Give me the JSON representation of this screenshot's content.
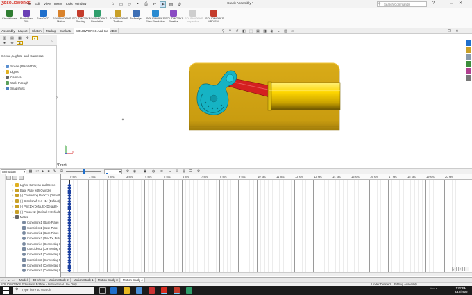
{
  "app": {
    "brand": "SOLIDWORKS",
    "menu": [
      "File",
      "Edit",
      "View",
      "Insert",
      "Tools",
      "Window"
    ],
    "document_title": "Crank Assembly *",
    "search_placeholder": "Search Commands"
  },
  "commands": [
    {
      "label": "CircuitWorks",
      "color": "#2f7d32",
      "disabled": false
    },
    {
      "label": "PhotoView 360",
      "color": "#6a3fb5",
      "disabled": false
    },
    {
      "label": "ScanTo3D",
      "color": "#1f6fcc",
      "disabled": false
    },
    {
      "label": "SOLIDWORKS Motion",
      "color": "#d9822b",
      "disabled": false
    },
    {
      "label": "SOLIDWORKS Routing",
      "color": "#c43c2c",
      "disabled": false
    },
    {
      "label": "SOLIDWORKS Simulation",
      "color": "#2f9e6b",
      "disabled": false
    },
    {
      "label": "SOLIDWORKS Toolbox",
      "color": "#c8a028",
      "disabled": false
    },
    {
      "label": "TolAnalyst",
      "color": "#3d6fb5",
      "disabled": false
    },
    {
      "label": "SOLIDWORKS Flow Simulation",
      "color": "#2a8bd1",
      "disabled": false
    },
    {
      "label": "SOLIDWORKS Plastics",
      "color": "#8a4bc3",
      "disabled": false
    },
    {
      "label": "SOLIDWORKS Inspection",
      "color": "#999999",
      "disabled": true
    },
    {
      "label": "SOLIDWORKS MBD SNL",
      "color": "#c43c2c",
      "disabled": false
    }
  ],
  "tabs": [
    {
      "label": "Assembly",
      "active": false
    },
    {
      "label": "Layout",
      "active": false
    },
    {
      "label": "Sketch",
      "active": false
    },
    {
      "label": "Markup",
      "active": false
    },
    {
      "label": "Evaluate",
      "active": false
    },
    {
      "label": "SOLIDWORKS Add-Ins",
      "active": true
    },
    {
      "label": "MBD",
      "active": false
    }
  ],
  "display_manager": {
    "header": "Scene, Lights, and Cameras",
    "items": [
      {
        "label": "Scene (Plain White)",
        "icon": "scene-icon"
      },
      {
        "label": "Lights",
        "icon": "light-icon"
      },
      {
        "label": "Camera",
        "icon": "camera-icon"
      },
      {
        "label": "Walk-through",
        "icon": "walkthrough-icon"
      },
      {
        "label": "Snapshots",
        "icon": "snapshot-icon"
      }
    ]
  },
  "viewport": {
    "view_label": "*Front",
    "colors": {
      "base": "#d4a514",
      "crank": "#16b3c4",
      "link": "#d42020",
      "piston": "#ffd700"
    }
  },
  "motion": {
    "study_type": "Animation",
    "tree": [
      {
        "label": "Lights, Cameras and Scene",
        "indent": 0,
        "icon": "lights-cameras-scene-icon",
        "color": "#e0b020"
      },
      {
        "label": "Base Plate with Cylinder",
        "indent": 0,
        "icon": "part-icon",
        "color": "#c8a028"
      },
      {
        "label": "(-) Connecting Rod<1> (Default)",
        "indent": 0,
        "icon": "part-icon",
        "color": "#c8a028"
      },
      {
        "label": "(-) Crankshaft<1> <1> (Default)",
        "indent": 0,
        "icon": "part-icon",
        "color": "#c8a028"
      },
      {
        "label": "(-) Pin<1> (Default<<Default>)",
        "indent": 0,
        "icon": "part-icon",
        "color": "#c8a028"
      },
      {
        "label": "(-) Piston<1> (Default<<Default>)",
        "indent": 0,
        "icon": "part-icon",
        "color": "#c8a028"
      },
      {
        "label": "Mates",
        "indent": 0,
        "icon": "mates-icon",
        "color": "#666666"
      },
      {
        "label": "Concentric1 (Base Plate)",
        "indent": 1,
        "icon": "concentric-mate-icon",
        "color": "#7a8aa0"
      },
      {
        "label": "Coincident1 (Base Plate)",
        "indent": 1,
        "icon": "coincident-mate-icon",
        "color": "#7a8aa0"
      },
      {
        "label": "Concentric2 (Base Plate)",
        "indent": 1,
        "icon": "concentric-mate-icon",
        "color": "#7a8aa0"
      },
      {
        "label": "Concentric3 (Pin<1>, Piston)",
        "indent": 1,
        "icon": "concentric-mate-icon",
        "color": "#7a8aa0"
      },
      {
        "label": "Concentric4 (Connecting Rod)",
        "indent": 1,
        "icon": "concentric-mate-icon",
        "color": "#7a8aa0"
      },
      {
        "label": "Coincident2 (Connecting Rod)",
        "indent": 1,
        "icon": "coincident-mate-icon",
        "color": "#7a8aa0"
      },
      {
        "label": "Concentric5 (Connecting Rod)",
        "indent": 1,
        "icon": "concentric-mate-icon",
        "color": "#7a8aa0"
      },
      {
        "label": "Coincident3 (Connecting Rod)",
        "indent": 1,
        "icon": "coincident-mate-icon",
        "color": "#7a8aa0"
      },
      {
        "label": "Concentric6 (Connecting Rod)",
        "indent": 1,
        "icon": "concentric-mate-icon",
        "color": "#7a8aa0"
      },
      {
        "label": "Concentric7 (Connecting Rod)",
        "indent": 1,
        "icon": "concentric-mate-icon",
        "color": "#7a8aa0"
      }
    ],
    "time_ticks": [
      "0 sec",
      "1 sec",
      "2 sec",
      "3 sec",
      "4 sec",
      "5 sec",
      "6 sec",
      "7 sec",
      "8 sec",
      "9 sec",
      "10 sec",
      "11 sec",
      "12 sec",
      "13 sec",
      "14 sec",
      "15 sec",
      "16 sec",
      "17 sec",
      "18 sec",
      "19 sec",
      "20 sec"
    ],
    "key_color": "#1a3fa0"
  },
  "bottom_tabs": [
    {
      "label": "Model",
      "active": false
    },
    {
      "label": "3D Views",
      "active": false
    },
    {
      "label": "Motion Study 2",
      "active": false
    },
    {
      "label": "Motion Study 1",
      "active": false
    },
    {
      "label": "Motion Study 3",
      "active": false
    },
    {
      "label": "Motion Study 4",
      "active": true
    }
  ],
  "status": {
    "left": "SOLIDWORKS Education Edition - Instructional Use Only",
    "middle": "Under Defined",
    "right": "Editing Assembly"
  },
  "taskbar": {
    "search_placeholder": "Type here to search",
    "time": "1:07 PM",
    "date": "3/18/2022"
  }
}
